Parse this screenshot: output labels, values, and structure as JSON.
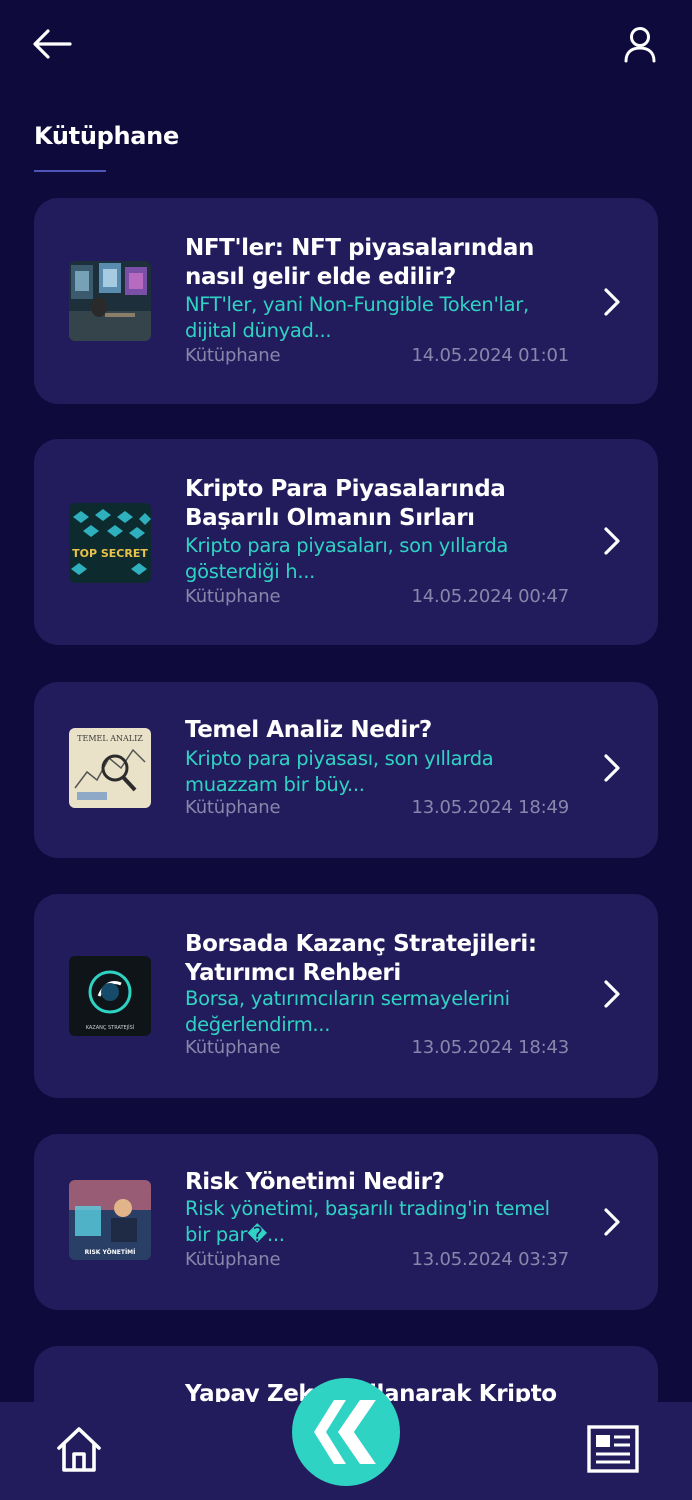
{
  "header": {
    "title": "Kütüphane"
  },
  "icons": {
    "back": "arrow-left-icon",
    "profile": "user-icon",
    "chevron": "chevron-right-icon",
    "home": "home-icon",
    "news": "newspaper-icon",
    "logo": "k-logo-icon"
  },
  "colors": {
    "background": "#0f0a3c",
    "card": "#231c5c",
    "accent": "#2fd3c3",
    "muted": "#8a86ab",
    "underline": "#4f55b8"
  },
  "articles": [
    {
      "title": "NFT'ler: NFT piyasalarından nasıl gelir elde edilir?",
      "snippet": "NFT'ler, yani Non-Fungible Token'lar, dijital dünyad...",
      "category": "Kütüphane",
      "date": "14.05.2024 01:01"
    },
    {
      "title": "Kripto Para Piyasalarında Başarılı Olmanın Sırları",
      "snippet": "Kripto para piyasaları, son yıllarda gösterdiği h...",
      "category": "Kütüphane",
      "date": "14.05.2024 00:47",
      "thumb_text": "TOP SECRET"
    },
    {
      "title": "Temel Analiz Nedir?",
      "snippet": "Kripto para piyasası, son yıllarda muazzam bir büy...",
      "category": "Kütüphane",
      "date": "13.05.2024 18:49",
      "thumb_text": "TEMEL ANALIZ"
    },
    {
      "title": "Borsada Kazanç Stratejileri: Yatırımcı Rehberi",
      "snippet": "Borsa, yatırımcıların sermayelerini değerlendirm...",
      "category": "Kütüphane",
      "date": "13.05.2024 18:43",
      "thumb_text": "KAZANÇ STRATEJİSİ"
    },
    {
      "title": "Risk Yönetimi Nedir?",
      "snippet": "Risk yönetimi, başarılı trading'in temel bir par�...",
      "category": "Kütüphane",
      "date": "13.05.2024 03:37",
      "thumb_text": "RISK YÖNETİMİ"
    },
    {
      "title": "Yapay Zeka Kullanarak Kripto"
    }
  ]
}
